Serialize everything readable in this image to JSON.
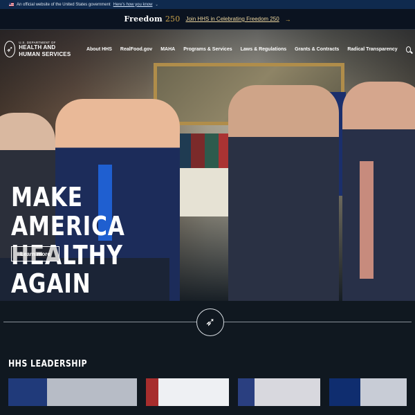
{
  "gov_banner": {
    "text": "An official website of the United States government",
    "link": "Here's how you know"
  },
  "freedom": {
    "logo_word": "Freedom",
    "logo_num": "250",
    "link": "Join HHS in Celebrating Freedom 250"
  },
  "header": {
    "logo_small": "U.S. DEPARTMENT OF",
    "logo_big": "HEALTH AND HUMAN SERVICES",
    "nav": [
      "About HHS",
      "RealFood.gov",
      "MAHA",
      "Programs & Services",
      "Laws & Regulations",
      "Grants & Contracts",
      "Radical Transparency"
    ]
  },
  "hero": {
    "title_line1": "MAKE AMERICA",
    "title_line2": "HEALTHY AGAIN",
    "button": "Learn more"
  },
  "leadership": {
    "title": "HHS LEADERSHIP"
  },
  "icons": [
    "flag-icon",
    "chevron-down-icon",
    "arrow-right-icon",
    "hhs-eagle-icon",
    "search-icon",
    "hhs-seal-icon"
  ],
  "colors": {
    "gov_banner_bg": "#0f2a4e",
    "page_bg": "#101820",
    "freedom_accent": "#e0b34f"
  }
}
